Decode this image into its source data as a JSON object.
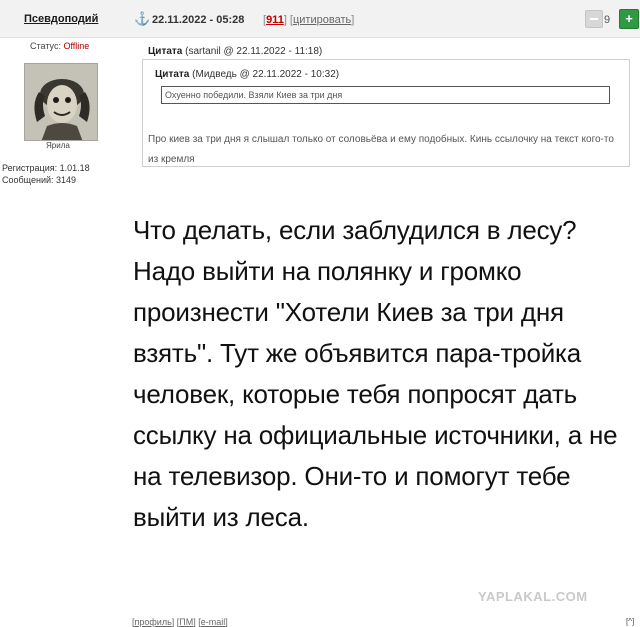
{
  "post": {
    "author": "Псевдоподий",
    "date": "22.11.2022 - 05:28",
    "links_open": "[",
    "post_number": "911",
    "links_sep": "] [",
    "quote_label": "цитировать",
    "links_close": "]",
    "rating": "9",
    "plus": "+"
  },
  "user": {
    "status_label": "Статус:",
    "status_value": "Offline",
    "avatar_caption": "Ярила",
    "registration": "Регистрация: 1.01.18",
    "messages": "Сообщений: 3149"
  },
  "quote_outer": {
    "label": "Цитата",
    "meta": "(sartanil @ 22.11.2022 - 11:18)",
    "reply": "Про киев за три дня я слышал только от соловьёва и ему подобных. Кинь ссылочку на текст кого-то из кремля"
  },
  "quote_inner": {
    "label": "Цитата",
    "meta": "(Мидведь @ 22.11.2022 - 10:32)",
    "text": "Охуенно победили. Взяли Киев за три дня"
  },
  "body_text": "Что делать, если заблудился в лесу? Надо выйти на полянку и громко произнести \"Хотели Киев за три дня взять\". Тут же объявится пара-тройка человек, которые тебя попросят дать ссылку на официальные источники, а не на телевизор. Они-то и помогут тебе выйти из леса.",
  "watermark": "YAPLAKAL.COM",
  "footer": {
    "b1": "[",
    "profile": "профиль",
    "s1": "] [",
    "pm": "ПМ",
    "s2": "] [",
    "email": "e-mail",
    "b2": "]",
    "top": "[^]"
  },
  "icons": {
    "anchor": "anchor-icon",
    "minus": "rate-minus-icon",
    "plus": "rate-plus-icon"
  },
  "colors": {
    "offline": "#b00000",
    "post_number": "#c00000",
    "plus_button": "#2f9a43",
    "header_bg": "#f2f2f2"
  }
}
